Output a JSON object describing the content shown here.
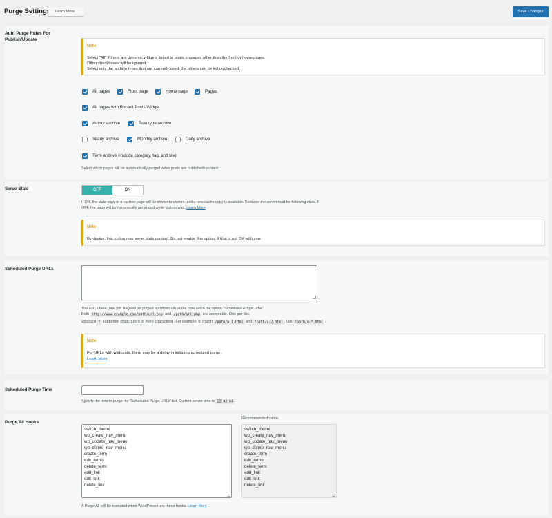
{
  "header": {
    "title": "Purge Settings",
    "learn_more": "Learn More",
    "save_label": "Save Changes"
  },
  "auto_purge": {
    "label": "Auto Purge Rules For Publish/Update",
    "note_title": "Note",
    "note_lines": [
      "Select \"All\" if there are dynamic widgets linked to posts on pages other than the front or home pages.",
      "Other checkboxes will be ignored.",
      "Select only the archive types that are currently used, the others can be left unchecked."
    ],
    "checkboxes": [
      {
        "label": "All pages",
        "checked": true
      },
      {
        "label": "Front page",
        "checked": true
      },
      {
        "label": "Home page",
        "checked": true
      },
      {
        "label": "Pages",
        "checked": true
      },
      {
        "label": "All pages with Recent Posts Widget",
        "checked": true
      },
      {
        "label": "Author archive",
        "checked": true
      },
      {
        "label": "Post type archive",
        "checked": true
      },
      {
        "label": "Yearly archive",
        "checked": false
      },
      {
        "label": "Monthly archive",
        "checked": true
      },
      {
        "label": "Daily archive",
        "checked": false
      },
      {
        "label": "Term archive (include category, tag, and tax)",
        "checked": true
      }
    ],
    "description": "Select which pages will be automatically purged when posts are published/updated."
  },
  "serve_stale": {
    "label": "Serve Stale",
    "off_label": "OFF",
    "on_label": "ON",
    "selected": "OFF",
    "desc_line1": "If ON, the stale copy of a cached page will be shown to visitors until a new cache copy is available. Reduces the server load for following visits. If",
    "desc_line2": "OFF, the page will be dynamically generated while visitors wait.",
    "learn_more": "Learn More",
    "note_title": "Note",
    "note_text": "By design, this option may serve stale content. Do not enable this option, if that is not OK with you."
  },
  "scheduled_urls": {
    "label": "Scheduled Purge URLs",
    "value": "",
    "desc1": "The URLs here (one per line) will be purged automatically at the time set in the option \"Scheduled Purge Time\".",
    "desc2_a": "Both",
    "desc2_code1": "http://www.example.com/path/url.php",
    "desc2_and": "and",
    "desc2_code2": "/path/url.php",
    "desc2_b": "are acceptable. One per line.",
    "desc3_a": "Wildcard",
    "desc3_code1": "*",
    "desc3_b": "supported (match zero or more characters). For example, to match",
    "desc3_code2": "/path/u-1.html",
    "desc3_and": "and",
    "desc3_code3": "/path/u-2.html",
    "desc3_use": ", use",
    "desc3_code4": "/path/u-*.html",
    "desc3_end": ".",
    "note_title": "Note",
    "note_text": "For URLs with wildcards, there may be a delay in initiating scheduled purge.",
    "note_link": "Learn More"
  },
  "scheduled_time": {
    "label": "Scheduled Purge Time",
    "value": "",
    "desc_a": "Specify the time to purge the \"Scheduled Purge URLs\" list. Current server time is",
    "server_time": "12:43:04",
    "desc_end": "."
  },
  "purge_all_hooks": {
    "label": "Purge All Hooks",
    "hooks": [
      "switch_theme",
      "wp_create_nav_menu",
      "wp_update_nav_menu",
      "wp_delete_nav_menu",
      "create_term",
      "edit_terms",
      "delete_term",
      "add_link",
      "edit_link",
      "delete_link"
    ],
    "recommended_label": "Recommended value:",
    "recommended": [
      "switch_theme",
      "wp_create_nav_menu",
      "wp_update_nav_menu",
      "wp_delete_nav_menu",
      "create_term",
      "edit_terms",
      "delete_term",
      "add_link",
      "edit_link",
      "delete_link"
    ],
    "desc": "A Purge All will be executed when WordPress runs these hooks.",
    "learn_more": "Learn More"
  },
  "colors": {
    "accent": "#2271b1",
    "note_border": "#dba617",
    "toggle_active": "#36b0a8"
  }
}
